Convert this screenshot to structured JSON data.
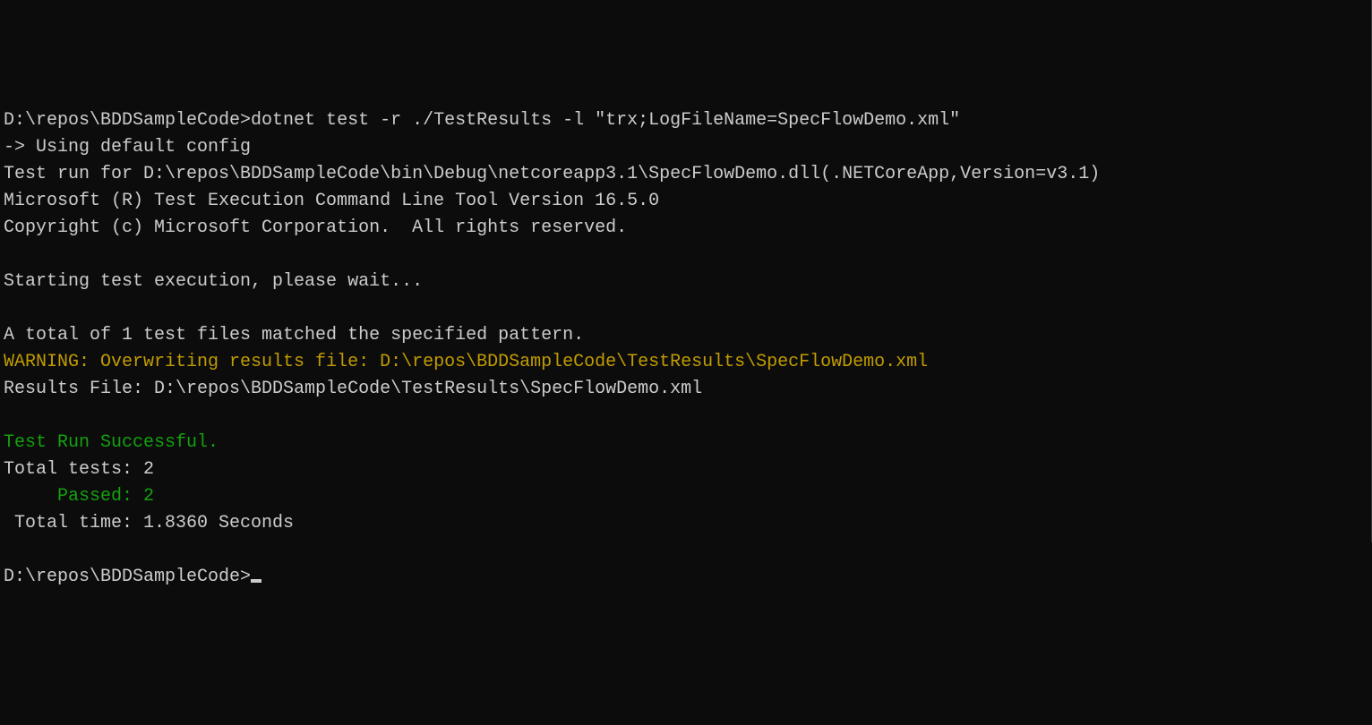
{
  "terminal": {
    "line0_partial": "",
    "prompt1": "D:\\repos\\BDDSampleCode>",
    "command1": "dotnet test -r ./TestResults -l \"trx;LogFileName=SpecFlowDemo.xml\"",
    "using_config": "-> Using default config",
    "test_run_for": "Test run for D:\\repos\\BDDSampleCode\\bin\\Debug\\netcoreapp3.1\\SpecFlowDemo.dll(.NETCoreApp,Version=v3.1)",
    "ms_tool": "Microsoft (R) Test Execution Command Line Tool Version 16.5.0",
    "copyright": "Copyright (c) Microsoft Corporation.  All rights reserved.",
    "starting": "Starting test execution, please wait...",
    "total_files": "A total of 1 test files matched the specified pattern.",
    "warning": "WARNING: Overwriting results file: D:\\repos\\BDDSampleCode\\TestResults\\SpecFlowDemo.xml",
    "results_file": "Results File: D:\\repos\\BDDSampleCode\\TestResults\\SpecFlowDemo.xml",
    "success": "Test Run Successful.",
    "total_tests": "Total tests: 2",
    "passed": "     Passed: 2",
    "total_time": " Total time: 1.8360 Seconds",
    "prompt2": "D:\\repos\\BDDSampleCode>"
  }
}
